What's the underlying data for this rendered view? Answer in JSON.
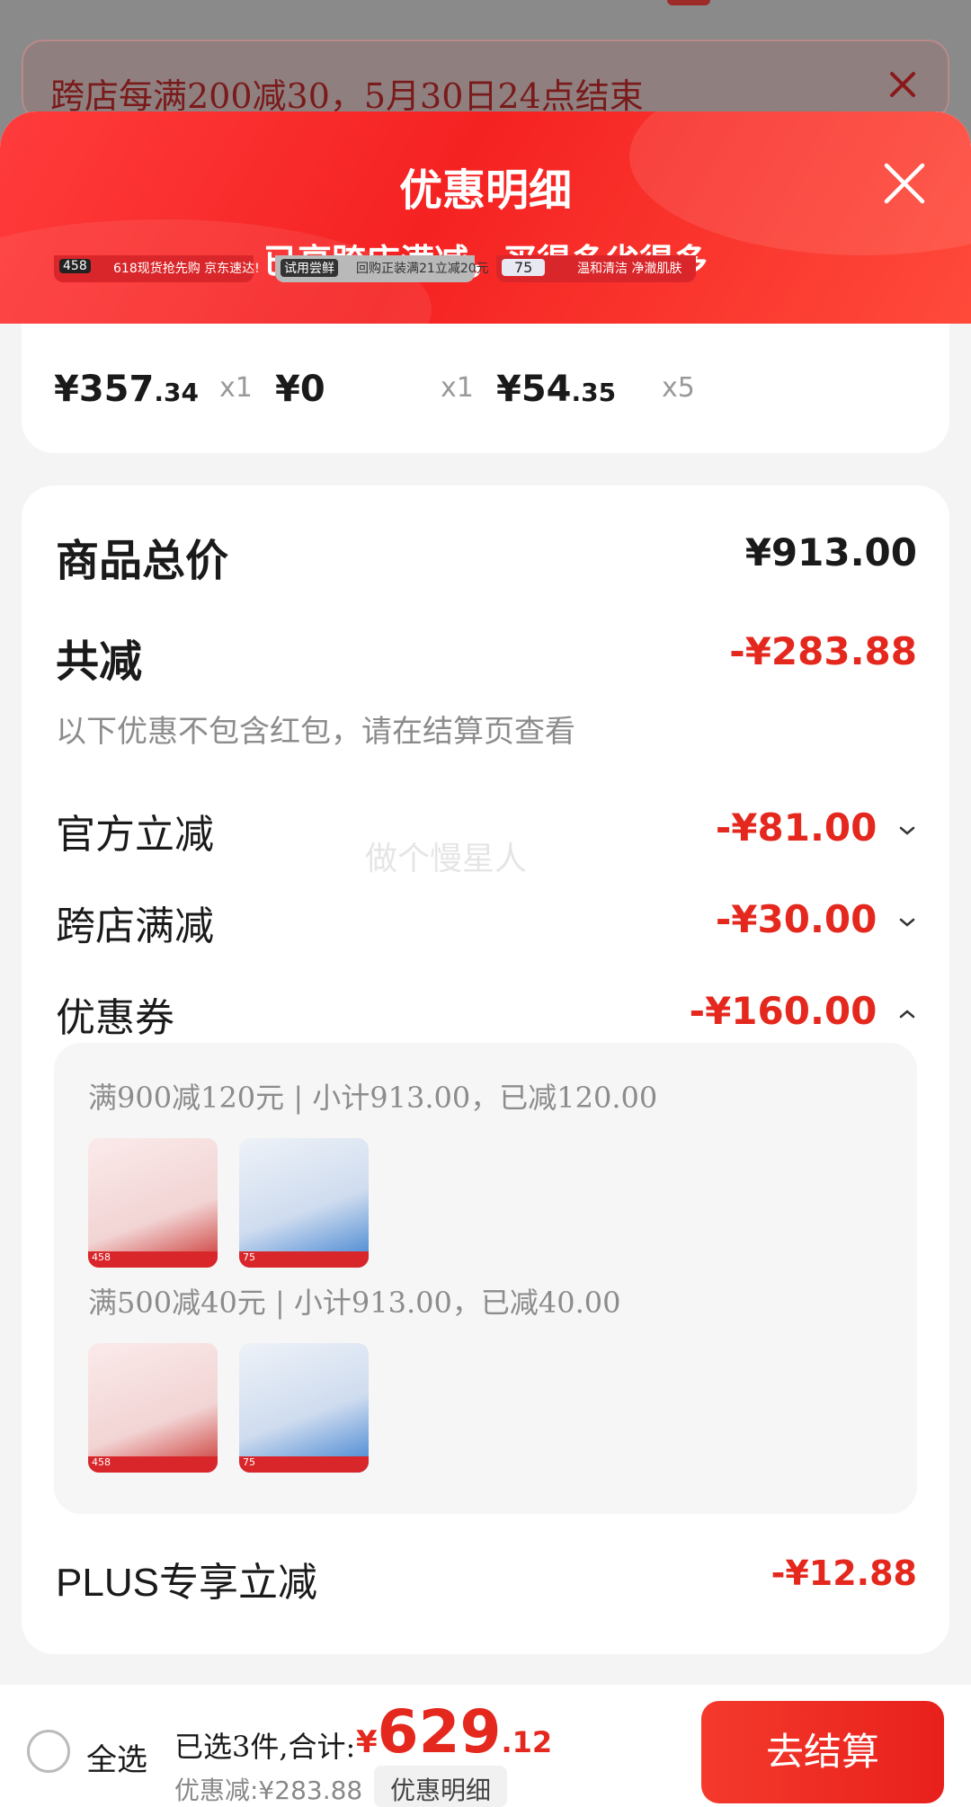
{
  "notice": {
    "text": "跨店每满200减30，5月30日24点结束"
  },
  "sheet": {
    "title": "优惠明细",
    "subtitle": "已享跨店满减，买得多省得多"
  },
  "products": [
    {
      "strip_badge": "458",
      "strip_text": "618现货抢先购 京东速达!",
      "price_int": "¥357",
      "price_dec": ".34",
      "qty": "x1"
    },
    {
      "strip_badge": "试用尝鲜",
      "strip_text": "回购正装满21立减20元",
      "price_int": "¥0",
      "price_dec": "",
      "qty": "x1"
    },
    {
      "strip_badge": "75",
      "strip_text": "温和清洁 净澈肌肤",
      "price_int": "¥54",
      "price_dec": ".35",
      "qty": "x5"
    }
  ],
  "summary": {
    "total_label": "商品总价",
    "total_value": "¥913.00",
    "reduce_label": "共减",
    "reduce_value": "-¥283.88",
    "hint": "以下优惠不包含红包，请在结算页查看",
    "watermark": "做个慢星人"
  },
  "discounts": [
    {
      "label": "官方立减",
      "value": "-¥81.00",
      "expanded": false
    },
    {
      "label": "跨店满减",
      "value": "-¥30.00",
      "expanded": false
    },
    {
      "label": "优惠券",
      "value": "-¥160.00",
      "expanded": true
    }
  ],
  "coupons": [
    {
      "text": "满900减120元 | 小计913.00，已减120.00",
      "thumbs": [
        "458",
        "75"
      ]
    },
    {
      "text": "满500减40元 | 小计913.00，已减40.00",
      "thumbs": [
        "458",
        "75"
      ]
    }
  ],
  "plus": {
    "label": "PLUS专享立减",
    "value": "-¥12.88"
  },
  "bottom": {
    "select_all": "全选",
    "summary": "已选3件,合计:",
    "currency": "¥",
    "total_int": "629",
    "total_dec": ".12",
    "saved": "优惠减:¥283.88",
    "detail_button": "优惠明细",
    "checkout": "去结算"
  },
  "colors": {
    "accent": "#e4281e",
    "header": "#f52222"
  }
}
